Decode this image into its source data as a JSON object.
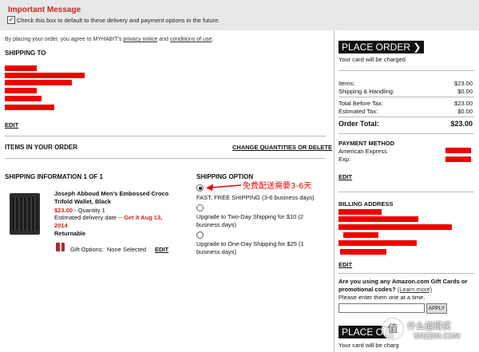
{
  "notice": {
    "title": "Important Message",
    "checkbox_label": "Check this box to default to these delivery and payment options in the future."
  },
  "agreement": {
    "prefix": "By placing your order, you agree to MYHABIT's",
    "privacy_link": "privacy notice",
    "and": "and",
    "conditions_link": "conditions of use",
    "suffix": "."
  },
  "shipping_to": {
    "heading": "SHIPPING TO",
    "edit": "EDIT"
  },
  "items": {
    "heading": "ITEMS IN YOUR ORDER",
    "change_link": "CHANGE QUANTITIES OR DELETE"
  },
  "shipping_info": {
    "heading": "SHIPPING INFORMATION 1 OF 1",
    "product_name_line1": "Joseph Abboud Men's Embossed Croco",
    "product_name_line2": "Trifold Wallet, Black",
    "price": "$23.00",
    "quantity": "- Quantity 1",
    "delivery_label": "Estimated delivery date --",
    "delivery_date_line1": "Get it Aug 13,",
    "delivery_date_line2": "2014",
    "returnable": "Returnable",
    "gift_options_label": "Gift Options:",
    "gift_options_value": "None Selected",
    "gift_edit": "EDIT"
  },
  "shipping_option": {
    "heading": "SHIPPING OPTION",
    "annotation": "免费配送需要3-6天",
    "options": [
      {
        "line1": "FAST, FREE SHIPPING (3-6 business days)",
        "line2": "",
        "selected": true
      },
      {
        "line1": "Upgrade to Two-Day Shipping for $10 (2",
        "line2": "business days)",
        "selected": false
      },
      {
        "line1": "Upgrade to One-Day Shipping for $25 (1",
        "line2": "business days)",
        "selected": false
      }
    ]
  },
  "sidebar": {
    "place_order": "PLACE ORDER",
    "charged_text": "Your card will be charged",
    "summary": [
      {
        "label": "Items:",
        "value": "$23.00"
      },
      {
        "label": "Shipping & Handling:",
        "value": "$0.00"
      },
      {
        "label": "Total Before Tax:",
        "value": "$23.00"
      },
      {
        "label": "Estimated Tax:",
        "value": "$0.00"
      }
    ],
    "order_total_label": "Order Total:",
    "order_total_value": "$23.00",
    "payment_heading": "PAYMENT METHOD",
    "payment_card": "American Express",
    "payment_exp": "Exp:",
    "payment_edit": "EDIT",
    "billing_heading": "BILLING ADDRESS",
    "billing_edit": "EDIT",
    "promo_question": "Are you using any Amazon.com Gift Cards or promotional codes?",
    "learn_more": "(Learn more)",
    "promo_instruction": "Please enter them one at a time.",
    "promo_placeholder": "",
    "apply": "APPLY",
    "place_order_bottom": "PLACE OR",
    "charged_text_bottom": "Your card will be charg"
  },
  "watermark": {
    "line1": "什么值得买",
    "line2": "SMZDM.COM"
  }
}
